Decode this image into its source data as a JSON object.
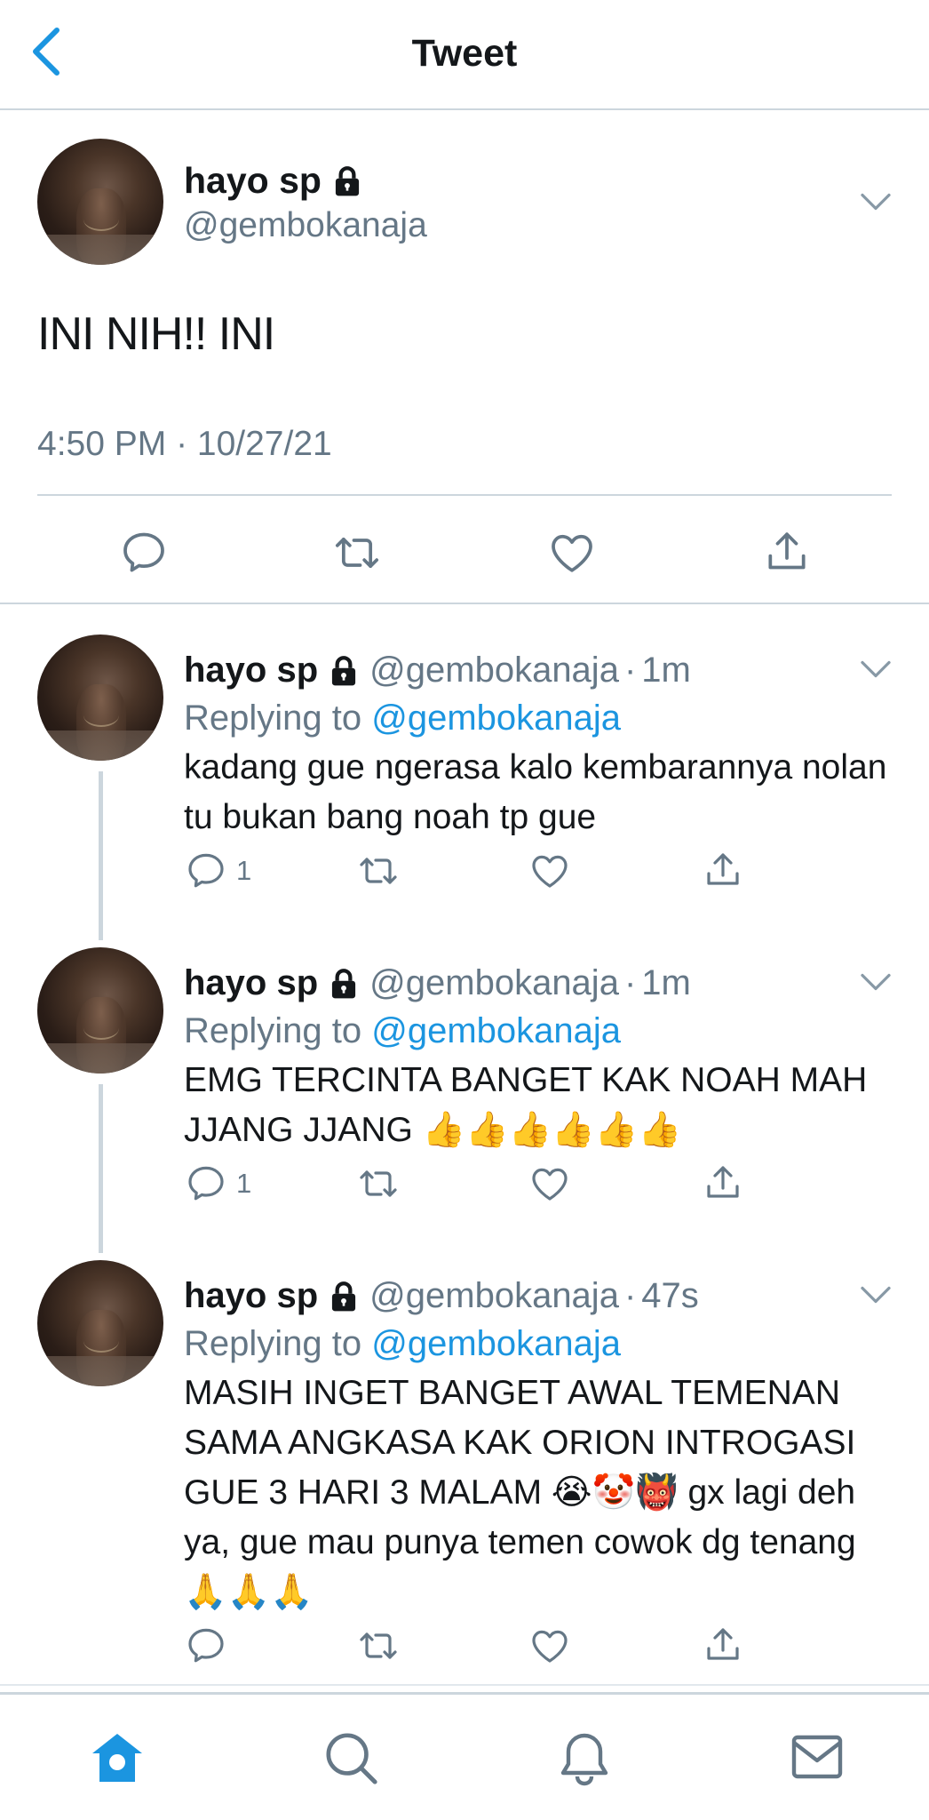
{
  "header": {
    "title": "Tweet"
  },
  "main_tweet": {
    "name": "hayo sp",
    "handle": "@gembokanaja",
    "text": "INI NIH!! INI",
    "timestamp": "4:50 PM · 10/27/21"
  },
  "replies": [
    {
      "name": "hayo sp",
      "handle": "@gembokanaja",
      "dot": "·",
      "time": "1m",
      "replying_prefix": "Replying to ",
      "replying_to": "@gembokanaja",
      "text": "kadang gue ngerasa kalo kembarannya nolan tu bukan bang noah tp gue",
      "reply_count": "1"
    },
    {
      "name": "hayo sp",
      "handle": "@gembokanaja",
      "dot": "·",
      "time": "1m",
      "replying_prefix": "Replying to ",
      "replying_to": "@gembokanaja",
      "text": "EMG TERCINTA BANGET KAK NOAH MAH JJANG JJANG 👍👍👍👍👍👍",
      "reply_count": "1"
    },
    {
      "name": "hayo sp",
      "handle": "@gembokanaja",
      "dot": "·",
      "time": "47s",
      "replying_prefix": "Replying to ",
      "replying_to": "@gembokanaja",
      "text": "MASIH INGET BANGET AWAL TEMENAN SAMA ANGKASA KAK ORION INTROGASI GUE 3 HARI 3 MALAM 😭🤡👹 gx lagi deh ya, gue mau punya temen cowok dg tenang🙏🙏🙏",
      "reply_count": ""
    }
  ],
  "colors": {
    "accent": "#1b95e0",
    "icon_gray": "#657786",
    "border": "#ccd6dd"
  },
  "icons": [
    "back-icon",
    "lock-icon",
    "chevron-down-icon",
    "reply-icon",
    "retweet-icon",
    "like-icon",
    "share-icon",
    "home-icon",
    "search-icon",
    "bell-icon",
    "mail-icon"
  ]
}
